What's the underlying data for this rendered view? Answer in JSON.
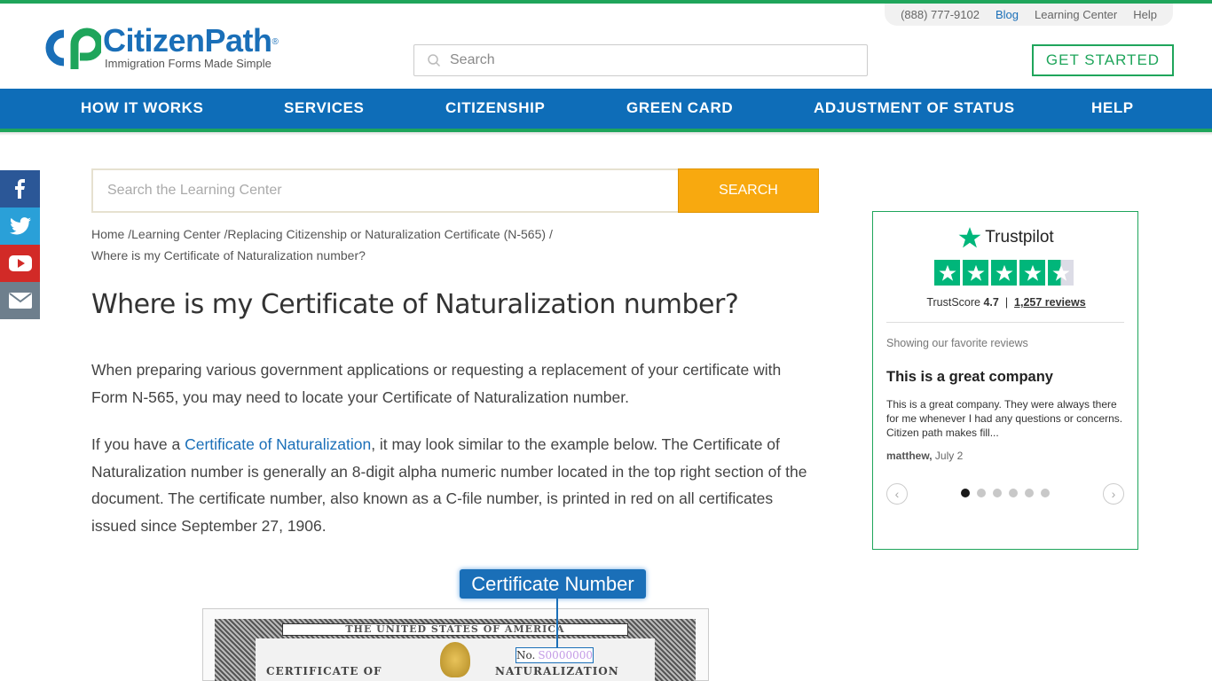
{
  "utility": {
    "phone": "(888) 777-9102",
    "blog": "Blog",
    "learning_center": "Learning Center",
    "help": "Help"
  },
  "logo": {
    "brand": "CitizenPath",
    "reg": "®",
    "tagline": "Immigration Forms Made Simple"
  },
  "header": {
    "search_placeholder": "Search",
    "get_started": "GET STARTED"
  },
  "nav": {
    "items": [
      "HOW IT WORKS",
      "SERVICES",
      "CITIZENSHIP",
      "GREEN CARD",
      "ADJUSTMENT OF STATUS",
      "HELP"
    ]
  },
  "social": {
    "icons": [
      "facebook-icon",
      "twitter-icon",
      "youtube-icon",
      "email-icon"
    ]
  },
  "learning_search": {
    "placeholder": "Search the Learning Center",
    "button": "SEARCH"
  },
  "breadcrumb": {
    "home": "Home",
    "sep": "/",
    "learning_center": "Learning Center",
    "parent": "Replacing Citizenship or Naturalization Certificate (N-565)",
    "current": "Where is my Certificate of Naturalization number?"
  },
  "article": {
    "title": "Where is my Certificate of Naturalization number?",
    "p1": "When preparing various government applications or requesting a replacement of your certificate with Form N-565, you may need to locate your Certificate of Naturalization number.",
    "p2_pre": "If you have a ",
    "p2_link": "Certificate of Naturalization",
    "p2_post": ", it may look similar to the example below. The Certificate of Naturalization number is generally an 8-digit alpha numeric number located in the top right section of the document. The certificate number, also known as a C-file number, is printed in red on all certificates issued since September 27, 1906."
  },
  "certificate_image": {
    "label": "Certificate Number",
    "banner": "THE UNITED STATES OF AMERICA",
    "no_prefix": "No.",
    "number": "S0000000",
    "left_text": "CERTIFICATE OF",
    "right_text": "NATURALIZATION"
  },
  "trustpilot": {
    "brand": "Trustpilot",
    "trustscore_label": "TrustScore",
    "score": "4.7",
    "separator": "|",
    "reviews": "1,257 reviews",
    "rating": 4.7,
    "showing": "Showing our favorite reviews",
    "review_title": "This is a great company",
    "review_text": "This is a great company. They were always there for me whenever I had any questions or concerns. Citizen path makes fill...",
    "author": "matthew,",
    "date": "July 2",
    "dot_count": 6,
    "active_dot": 0,
    "prev": "‹",
    "next": "›",
    "accent": "#00b67a"
  },
  "colors": {
    "nav_blue": "#0e6db8",
    "brand_green": "#1fa55b",
    "search_orange": "#f8a90f",
    "link_blue": "#1a6fb8"
  }
}
